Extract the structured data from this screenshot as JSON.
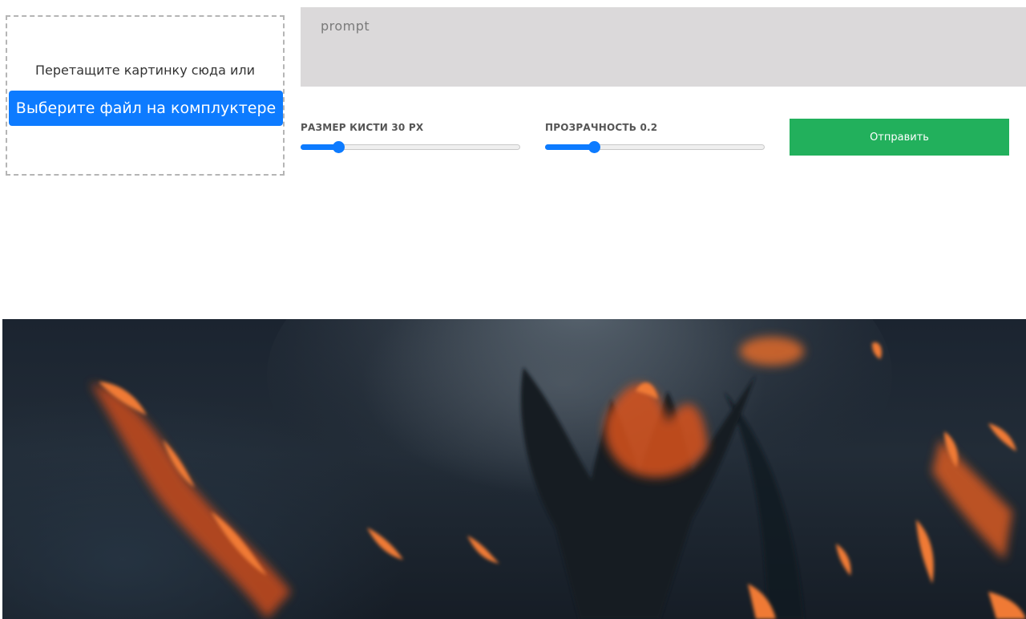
{
  "dropzone": {
    "text": "Перетащите картинку сюда или",
    "button_label": "Выберите файл на комплуктере"
  },
  "prompt": {
    "placeholder": "prompt",
    "value": ""
  },
  "brush_slider": {
    "label": "РАЗМЕР КИСТИ 30 PX",
    "value_fraction": 0.17
  },
  "opacity_slider": {
    "label": "ПРОЗРАЧНОСТЬ 0.2",
    "value_fraction": 0.22
  },
  "submit": {
    "label": "Отправить"
  },
  "colors": {
    "primary_blue": "#0d7bff",
    "submit_green": "#22b05c",
    "prompt_bg": "#dbd9da",
    "fire_orange": "#e8642a"
  }
}
